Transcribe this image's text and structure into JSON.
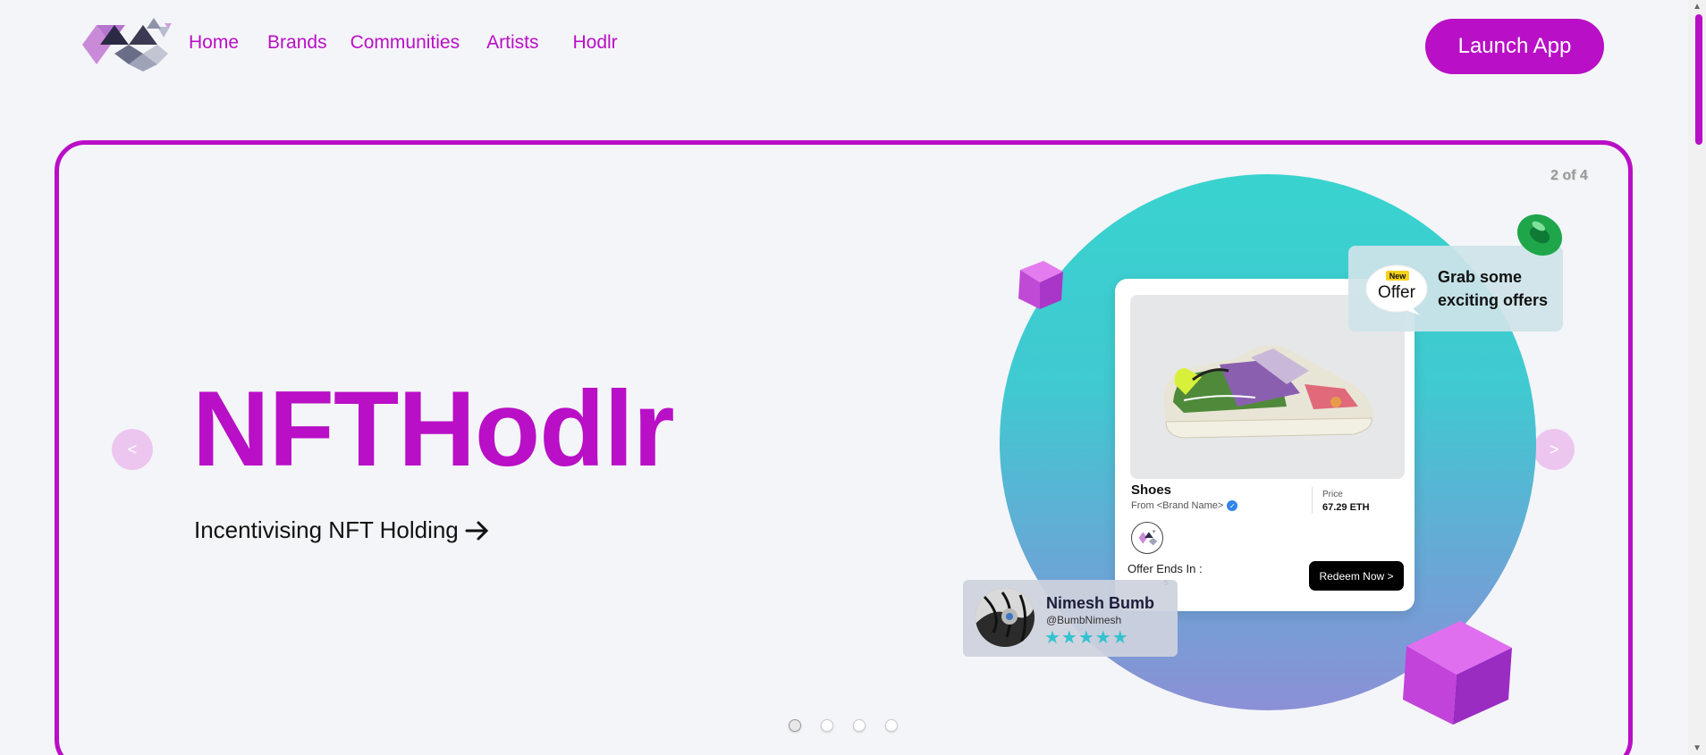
{
  "nav": {
    "items": [
      "Home",
      "Brands",
      "Communities",
      "Artists",
      "Hodlr"
    ],
    "launch_label": "Launch App"
  },
  "hero": {
    "counter": "2 of 4",
    "title": "NFTHodlr",
    "tagline": "Incentivising NFT Holding",
    "prev_label": "<",
    "next_label": ">",
    "slides_total": 4,
    "active_slide": 1
  },
  "card": {
    "product_name": "Shoes",
    "from_text": "From <Brand Name>",
    "price_label": "Price",
    "price_value": "67.29 ETH",
    "offer_ends_label": "Offer Ends In :",
    "timer_visible": "s",
    "redeem_label": "Redeem Now >"
  },
  "offer": {
    "bubble_top": "New",
    "bubble_main": "Offer",
    "text": "Grab some exciting offers"
  },
  "user": {
    "name": "Nimesh Bumb",
    "handle": "@BumbNimesh",
    "stars": "★★★★★"
  },
  "colors": {
    "brand": "#b90fc6",
    "teal": "#39d3cf",
    "black": "#000000"
  },
  "icons": [
    "logo-icon",
    "arrow-right-icon",
    "verified-icon",
    "cube-icon",
    "ring-icon",
    "shoe-image"
  ]
}
